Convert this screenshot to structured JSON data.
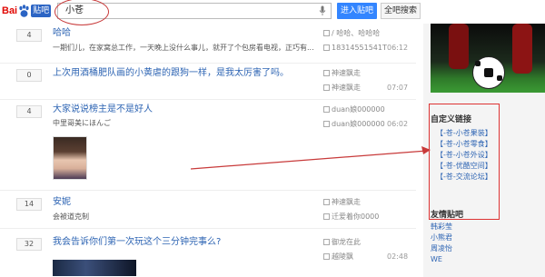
{
  "logo": {
    "bai": "Bai",
    "tieba": "贴吧"
  },
  "search": {
    "value": "小苍",
    "enter_label": "进入贴吧",
    "all_label": "全吧搜索"
  },
  "threads": [
    {
      "count": "4",
      "title": "哈哈",
      "snippet": "一期们儿，在家窝总工作，一天晚上没什么事儿，就开了个包房看电视，正巧有...",
      "author": "/ 哈哈、哈哈哈",
      "last": "18314551541T",
      "time": "06:12"
    },
    {
      "count": "0",
      "title": "上次用酒桶肥队画的小黄虐的跟狗一样，是我太厉害了吗。",
      "snippet": "",
      "author": "神速飘走",
      "last": "神速飘走",
      "time": "07:07"
    },
    {
      "count": "4",
      "title": "大家说说榜主是不是好人",
      "snippet": "中里哥美にほんご",
      "author": "duan娘000000",
      "last": "duan娘000000",
      "time": "06:02"
    },
    {
      "count": "14",
      "title": "安妮",
      "snippet": "会被道克制",
      "author": "神速飘走",
      "last": "迁爱着你0000",
      "time": ""
    },
    {
      "count": "32",
      "title": "我会告诉你们第一次玩这个三分钟完事么?",
      "snippet": "",
      "author": "御龙在此",
      "last": "越陵飘",
      "time": "02:48"
    }
  ],
  "sidebar": {
    "custom_links_title": "自定义链接",
    "links": [
      "【-苍-小苍果装】",
      "【-苍-小苍零食】",
      "【-苍-小苍外设】",
      "【-苍-优酷空间】",
      "【-苍-交流论坛】"
    ],
    "friends_title": "友情贴吧",
    "friends": [
      "韩彩莹",
      "小熊君",
      "周凌怡",
      "WE"
    ]
  },
  "colors": {
    "annotation": "#c83a3a",
    "link": "#2d64b3",
    "button": "#3385ff"
  }
}
